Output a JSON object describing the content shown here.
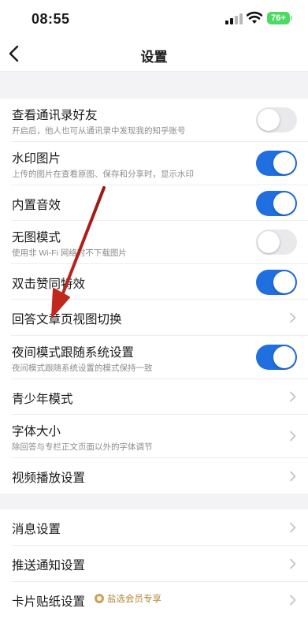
{
  "status_bar": {
    "time": "08:55",
    "battery": "76+"
  },
  "nav": {
    "title": "设置"
  },
  "settings_group_1": [
    {
      "title": "查看通讯录好友",
      "subtitle": "开启后，他人也可从通讯录中发现我的知乎账号",
      "control": "toggle",
      "enabled": false
    },
    {
      "title": "水印图片",
      "subtitle": "上传的图片在查看原图、保存和分享时，显示水印",
      "control": "toggle",
      "enabled": true
    },
    {
      "title": "内置音效",
      "subtitle": "",
      "control": "toggle",
      "enabled": true
    },
    {
      "title": "无图模式",
      "subtitle": "使用非 Wi-Fi 网络时不下载图片",
      "control": "toggle",
      "enabled": false
    },
    {
      "title": "双击赞同特效",
      "subtitle": "",
      "control": "toggle",
      "enabled": true
    },
    {
      "title": "回答文章页视图切换",
      "subtitle": "",
      "control": "chevron"
    },
    {
      "title": "夜间模式跟随系统设置",
      "subtitle": "夜间模式跟随系统设置的模式保持一致",
      "control": "toggle",
      "enabled": true
    },
    {
      "title": "青少年模式",
      "subtitle": "",
      "control": "chevron"
    },
    {
      "title": "字体大小",
      "subtitle": "除回答与专栏正文页面以外的字体调节",
      "control": "chevron"
    },
    {
      "title": "视频播放设置",
      "subtitle": "",
      "control": "chevron"
    }
  ],
  "settings_group_2": [
    {
      "title": "消息设置",
      "control": "chevron"
    },
    {
      "title": "推送通知设置",
      "control": "chevron"
    },
    {
      "title": "卡片贴纸设置",
      "control": "chevron",
      "badge": "盐选会员专享"
    }
  ],
  "colors": {
    "accent": "#1f6fe0",
    "annotation": "#c0281e",
    "badge": "#b38b3c"
  }
}
